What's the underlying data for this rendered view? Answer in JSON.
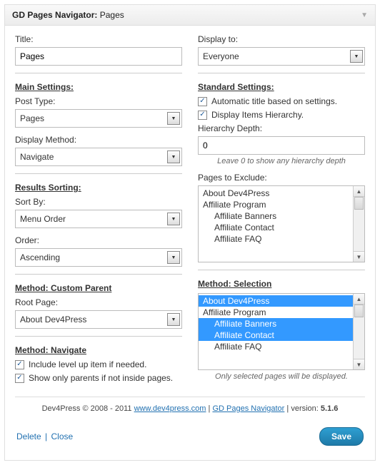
{
  "header": {
    "prefix": "GD Pages Navigator:",
    "suffix": "Pages"
  },
  "left": {
    "title_label": "Title:",
    "title_value": "Pages",
    "main_settings_h": "Main Settings:",
    "post_type_label": "Post Type:",
    "post_type_value": "Pages",
    "display_method_label": "Display Method:",
    "display_method_value": "Navigate",
    "results_sorting_h": "Results Sorting:",
    "sort_by_label": "Sort By:",
    "sort_by_value": "Menu Order",
    "order_label": "Order:",
    "order_value": "Ascending",
    "method_custom_parent_h": "Method: Custom Parent",
    "root_page_label": "Root Page:",
    "root_page_value": "About Dev4Press",
    "method_navigate_h": "Method: Navigate",
    "cb_level_up": "Include level up item if needed.",
    "cb_parents_only": "Show only parents if not inside pages."
  },
  "right": {
    "display_to_label": "Display to:",
    "display_to_value": "Everyone",
    "standard_settings_h": "Standard Settings:",
    "cb_auto_title": "Automatic title based on settings.",
    "cb_hierarchy": "Display Items Hierarchy.",
    "hierarchy_depth_label": "Hierarchy Depth:",
    "hierarchy_depth_value": "0",
    "hierarchy_hint": "Leave 0 to show any hierarchy depth",
    "pages_exclude_label": "Pages to Exclude:",
    "exclude_items": {
      "i0": "About Dev4Press",
      "i1": "Affiliate Program",
      "i2": "Affiliate Banners",
      "i3": "Affiliate Contact",
      "i4": "Affiliate FAQ"
    },
    "method_selection_h": "Method: Selection",
    "selection_items": {
      "i0": "About Dev4Press",
      "i1": "Affiliate Program",
      "i2": "Affiliate Banners",
      "i3": "Affiliate Contact",
      "i4": "Affiliate FAQ"
    },
    "selection_hint": "Only selected pages will be displayed."
  },
  "footer": {
    "copyright": "Dev4Press © 2008 - 2011",
    "site_link": "www.dev4press.com",
    "plugin_link": "GD Pages Navigator",
    "version_label": "version:",
    "version": "5.1.6",
    "sep": " | ",
    "delete": "Delete",
    "close": "Close",
    "save": "Save"
  }
}
